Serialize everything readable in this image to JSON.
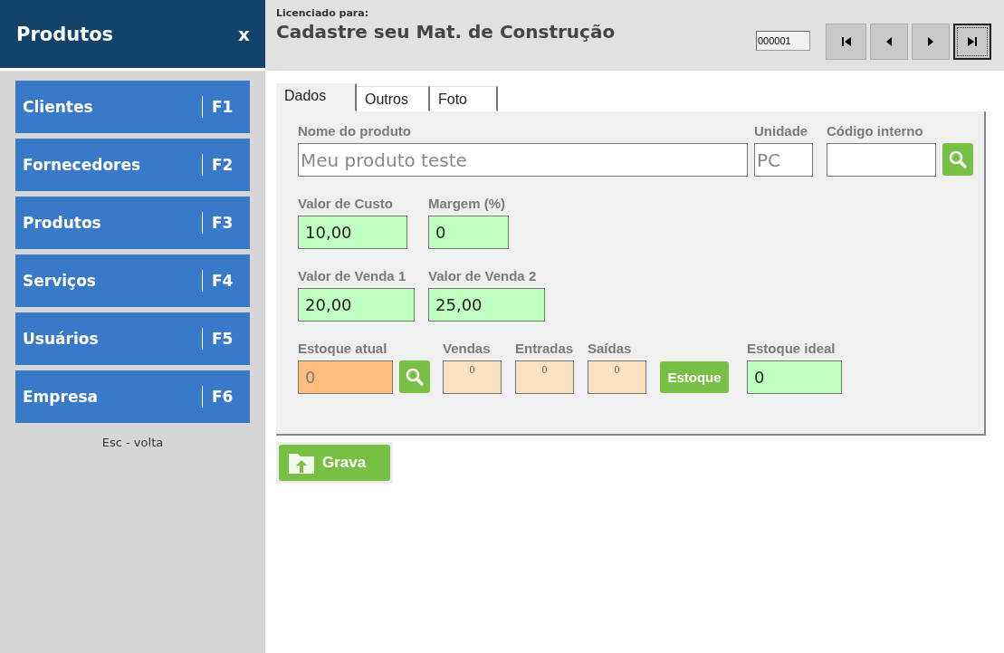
{
  "sidebar": {
    "title": "Produtos",
    "close": "x",
    "items": [
      {
        "label": "Clientes",
        "key": "F1"
      },
      {
        "label": "Fornecedores",
        "key": "F2"
      },
      {
        "label": "Produtos",
        "key": "F3"
      },
      {
        "label": "Serviços",
        "key": "F4"
      },
      {
        "label": "Usuários",
        "key": "F5"
      },
      {
        "label": "Empresa",
        "key": "F6"
      }
    ],
    "hint": "Esc - volta"
  },
  "header": {
    "caption": "Licenciado para:",
    "title": "Cadastre seu Mat. de Construção",
    "record": "000001",
    "nav": [
      {
        "kind": "first",
        "focused": false
      },
      {
        "kind": "prev",
        "focused": false
      },
      {
        "kind": "next",
        "focused": false
      },
      {
        "kind": "last",
        "focused": true
      }
    ]
  },
  "tabs": [
    {
      "label": "Dados",
      "selected": true
    },
    {
      "label": "Outros",
      "selected": false
    },
    {
      "label": "Foto",
      "selected": false
    }
  ],
  "form": {
    "lines": [
      {
        "fields": [
          {
            "kind": "plain",
            "label": "Nome do produto",
            "value": "Meu produto teste"
          },
          {
            "kind": "plain",
            "label": "Unidade",
            "value": "PC"
          },
          {
            "kind": "plain",
            "label": "Código interno"
          },
          {
            "kind": "search"
          }
        ]
      },
      {
        "fields": [
          {
            "kind": "money",
            "label": "Valor de Custo",
            "value": "10,00"
          },
          {
            "kind": "money",
            "label": "Margem (%)",
            "value": "0"
          }
        ]
      },
      {
        "fields": [
          {
            "kind": "money",
            "label": "Valor de Venda 1",
            "value": "20,00"
          },
          {
            "kind": "money",
            "label": "Valor de Venda 2",
            "value": "25,00"
          }
        ]
      },
      {
        "fields": [
          {
            "kind": "stock",
            "label": "Estoque atual",
            "value": "0"
          },
          {
            "kind": "search"
          },
          {
            "kind": "readout",
            "label": "Vendas",
            "value": "0"
          },
          {
            "kind": "readout",
            "label": "Entradas",
            "value": "0"
          },
          {
            "kind": "readout",
            "label": "Saídas",
            "value": "0"
          },
          {
            "kind": "button",
            "label": "Estoque"
          },
          {
            "kind": "money",
            "label": "Estoque ideal",
            "value": "0"
          }
        ]
      }
    ]
  },
  "save_button": {
    "label": "Grava"
  }
}
